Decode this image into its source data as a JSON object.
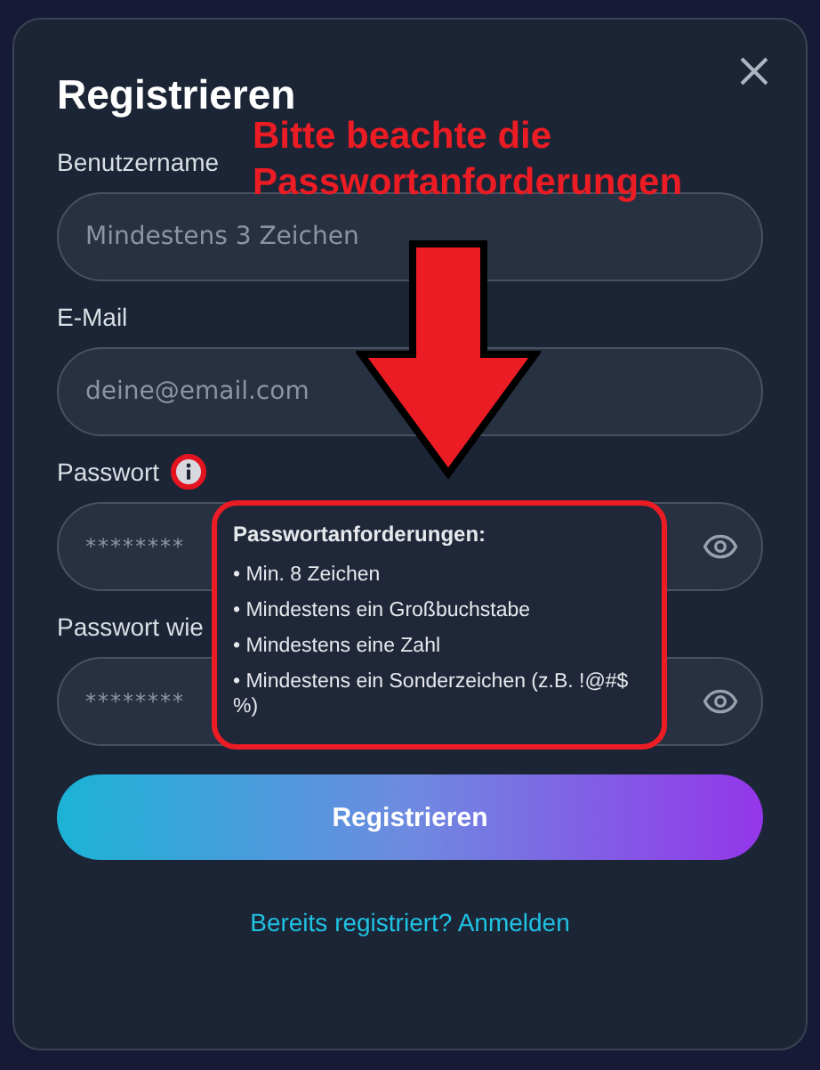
{
  "dialog": {
    "title": "Registrieren"
  },
  "fields": [
    {
      "label": "Benutzername",
      "placeholder": "Mindestens 3 Zeichen",
      "kind": "text"
    },
    {
      "label": "E-Mail",
      "placeholder": "deine@email.com",
      "kind": "text"
    },
    {
      "label": "Passwort",
      "placeholder": "********",
      "kind": "password",
      "info": true
    },
    {
      "label": "Passwort wie",
      "placeholder": "********",
      "kind": "password"
    }
  ],
  "submit": "Registrieren",
  "login_link": "Bereits registriert? Anmelden",
  "annotation": {
    "lines": [
      "Bitte beachte die",
      "Passwortanforderungen"
    ]
  },
  "tooltip": {
    "title": "Passwortanforderungen:",
    "items": [
      "• Min. 8 Zeichen",
      "• Mindestens ein Großbuchstabe",
      "• Mindestens eine Zahl",
      "• Mindestens ein Sonderzeichen (z.B. !@#$ %)"
    ]
  }
}
